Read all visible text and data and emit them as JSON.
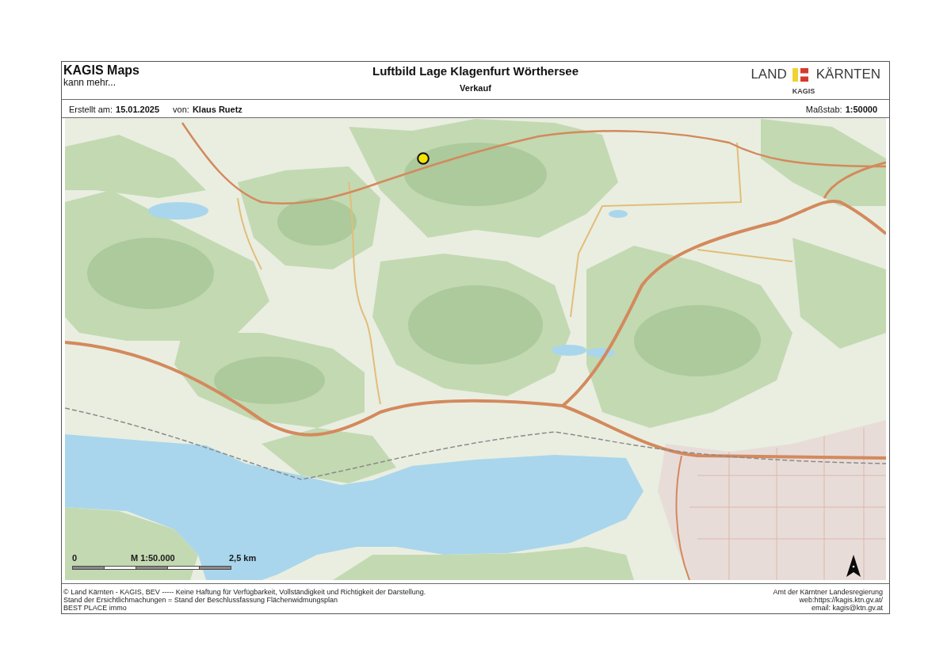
{
  "header": {
    "app_name": "KAGIS Maps",
    "tagline": "kann mehr...",
    "title": "Luftbild Lage Klagenfurt Wörthersee",
    "subtitle": "Verkauf",
    "logo": {
      "left_text": "LAND",
      "right_text": "KÄRNTEN",
      "caption": "KAGIS"
    }
  },
  "info_bar": {
    "left": [
      {
        "label": "Erstellt am:",
        "value": "15.01.2025"
      },
      {
        "label": "von:",
        "value": "Klaus Ruetz"
      }
    ],
    "right": [
      {
        "label": "Maßstab:",
        "value": "1:50000"
      }
    ]
  },
  "map": {
    "scale_bar": {
      "start": "0",
      "title": "M 1:50.000",
      "end": "2,5 km"
    }
  },
  "footer": {
    "left": [
      "© Land Kärnten - KAGIS, BEV ----- Keine Haftung für Verfügbarkeit, Vollständigkeit und Richtigkeit der Darstellung.",
      "Stand der Ersichtlichmachungen = Stand der Beschlussfassung Flächenwidmungsplan",
      "BEST PLACE immo"
    ],
    "right": [
      "Amt der Kärntner Landesregierung",
      "web:https://kagis.ktn.gv.at/",
      "email: kagis@ktn.gv.at"
    ]
  }
}
